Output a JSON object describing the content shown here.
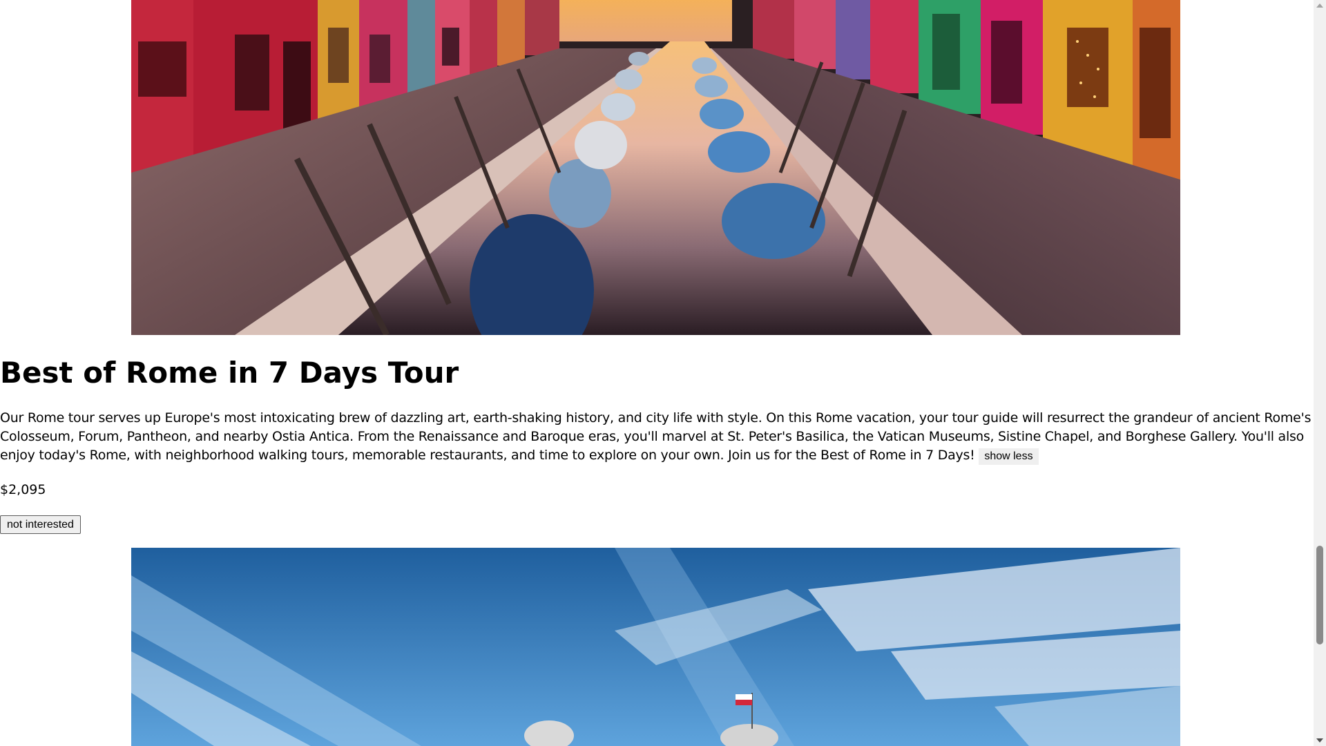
{
  "tour": {
    "top_image_alt": "Colorful canal with moored boats at sunset",
    "title": "Best of Rome in 7 Days Tour",
    "description": "Our Rome tour serves up Europe's most intoxicating brew of dazzling art, earth-shaking history, and city life with style. On this Rome vacation, your tour guide will resurrect the grandeur of ancient Rome's Colosseum, Forum, Pantheon, and nearby Ostia Antica. From the Renaissance and Baroque eras, you'll marvel at St. Peter's Basilica, the Vatican Museums, Sistine Chapel, and Borghese Gallery. You'll also enjoy today's Rome, with neighborhood walking tours, memorable restaurants, and time to explore on your own. Join us for the Best of Rome in 7 Days!",
    "show_less_label": "show less",
    "price": "$2,095",
    "not_interested_label": "not interested"
  },
  "next_tour": {
    "image_alt": "Castle towers under a streaked blue sky with a red and white flag"
  },
  "colors": {
    "page_background": "#ffffff",
    "button_background": "#efefef",
    "scrollbar_thumb": "#8a8a8a"
  }
}
